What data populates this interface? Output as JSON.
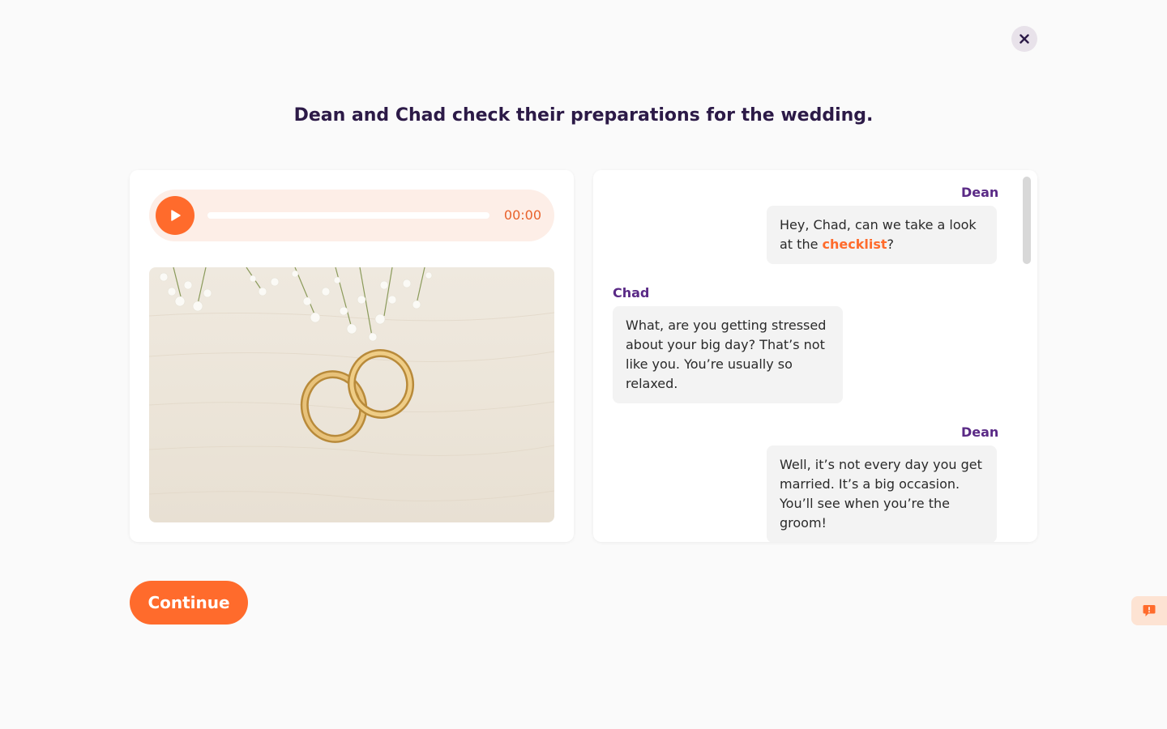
{
  "title": "Dean and Chad check their preparations for the wedding.",
  "audio": {
    "time": "00:00",
    "progress": 0
  },
  "image": {
    "alt": ""
  },
  "dialogue": [
    {
      "speaker": "Dean",
      "side": "right",
      "parts": [
        {
          "text": "Hey, Chad, can we take a look at the "
        },
        {
          "text": "checklist",
          "highlight": true
        },
        {
          "text": "?"
        }
      ]
    },
    {
      "speaker": "Chad",
      "side": "left",
      "parts": [
        {
          "text": "What, are you getting stressed about your big day? That’s not like you. You’re usually so relaxed."
        }
      ]
    },
    {
      "speaker": "Dean",
      "side": "right",
      "parts": [
        {
          "text": "Well, it’s not every day you get married. It’s a big occasion. You’ll see when you’re the groom!"
        }
      ]
    }
  ],
  "buttons": {
    "continue": "Continue"
  },
  "colors": {
    "accent": "#ff6b2c",
    "title": "#2c1a47",
    "speaker": "#5a2a86",
    "bubble": "#f3f3f3"
  },
  "icons": {
    "close": "close-icon",
    "play": "play-icon",
    "feedback": "feedback-icon"
  }
}
